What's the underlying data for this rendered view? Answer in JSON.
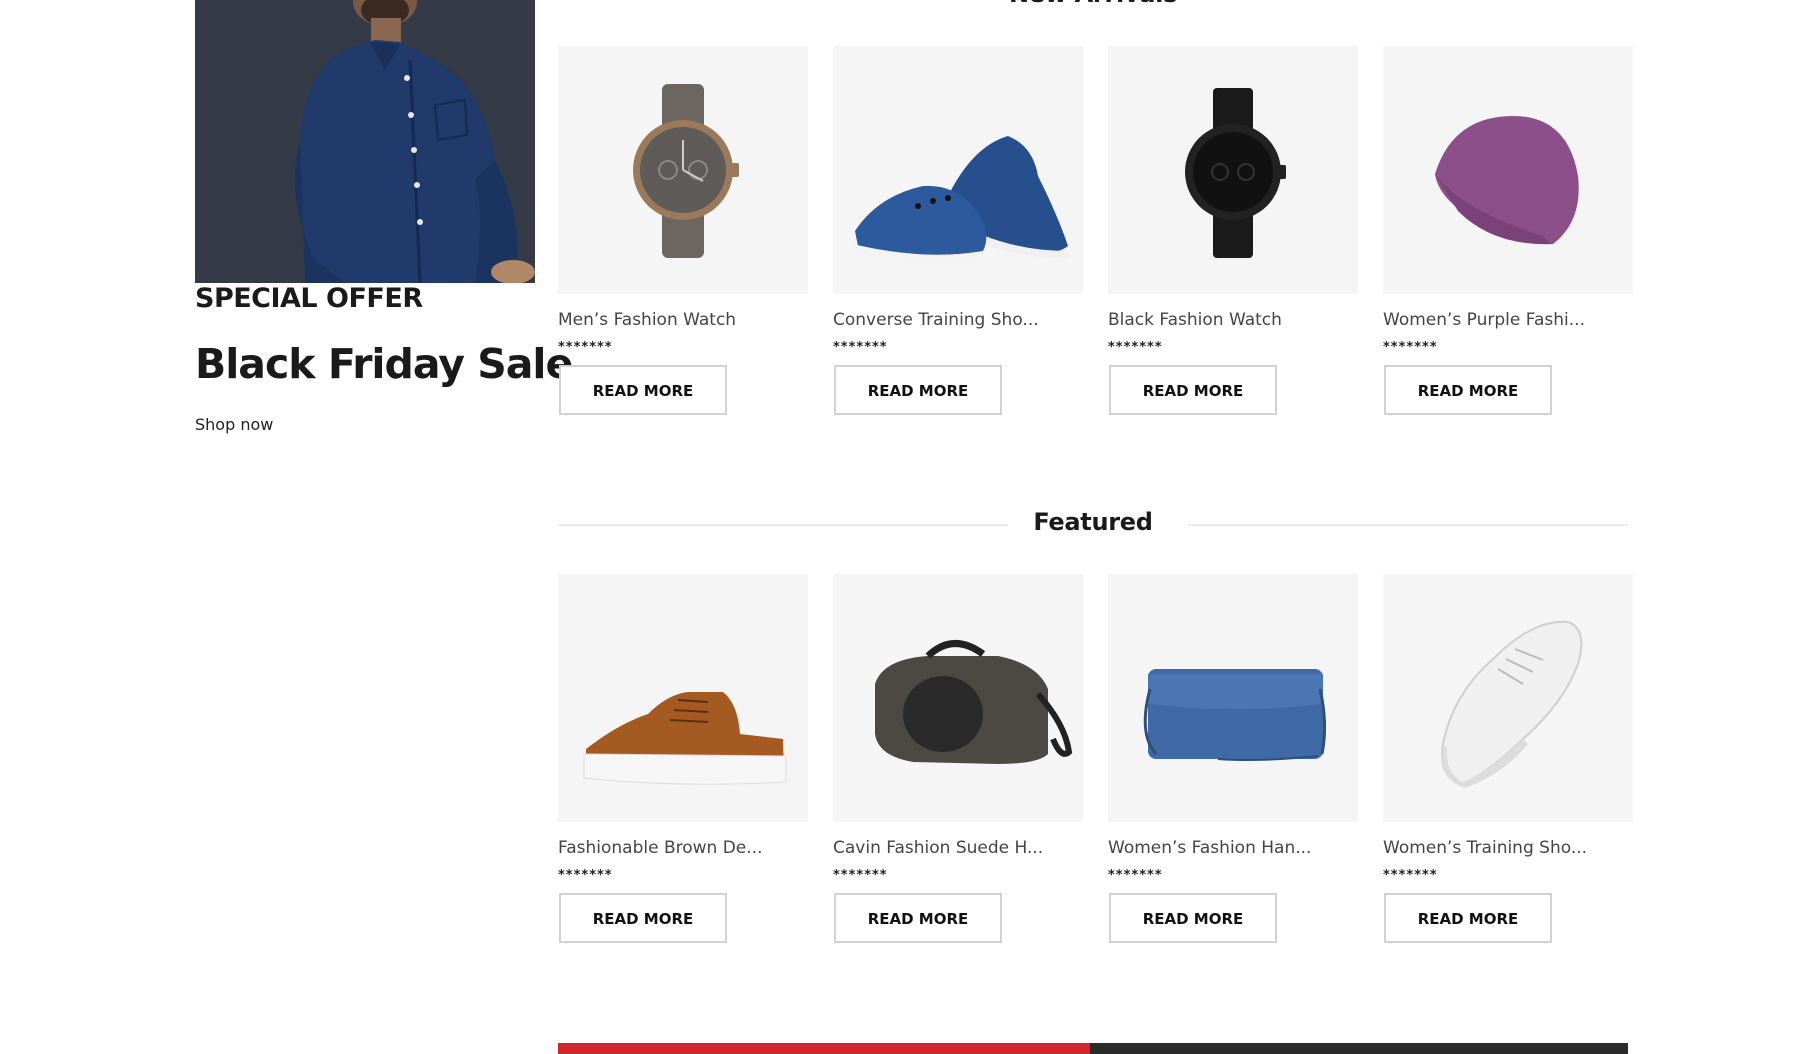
{
  "promo": {
    "label": "SPECIAL OFFER",
    "title": "Black Friday Sale",
    "link": "Shop now"
  },
  "sections": [
    {
      "title": "New Arrivals",
      "products": [
        {
          "name": "Men’s Fashion Watch",
          "rating": "*******",
          "button": "READ MORE",
          "image": "brown-watch"
        },
        {
          "name": "Converse Training Sho...",
          "rating": "*******",
          "button": "READ MORE",
          "image": "blue-sneakers"
        },
        {
          "name": "Black Fashion Watch",
          "rating": "*******",
          "button": "READ MORE",
          "image": "black-watch"
        },
        {
          "name": "Women’s Purple Fashi...",
          "rating": "*******",
          "button": "READ MORE",
          "image": "purple-beanie"
        }
      ]
    },
    {
      "title": "Featured",
      "products": [
        {
          "name": "Fashionable Brown De...",
          "rating": "*******",
          "button": "READ MORE",
          "image": "brown-shoe"
        },
        {
          "name": "Cavin Fashion Suede H...",
          "rating": "*******",
          "button": "READ MORE",
          "image": "duffel-bag"
        },
        {
          "name": "Women’s Fashion Han...",
          "rating": "*******",
          "button": "READ MORE",
          "image": "blue-handbag"
        },
        {
          "name": "Women’s Training Sho...",
          "rating": "*******",
          "button": "READ MORE",
          "image": "white-sneaker"
        }
      ]
    }
  ],
  "colors": {
    "banner_left": "#d2262c",
    "banner_right": "#2b2b2b",
    "card_bg": "#f5f5f5"
  }
}
